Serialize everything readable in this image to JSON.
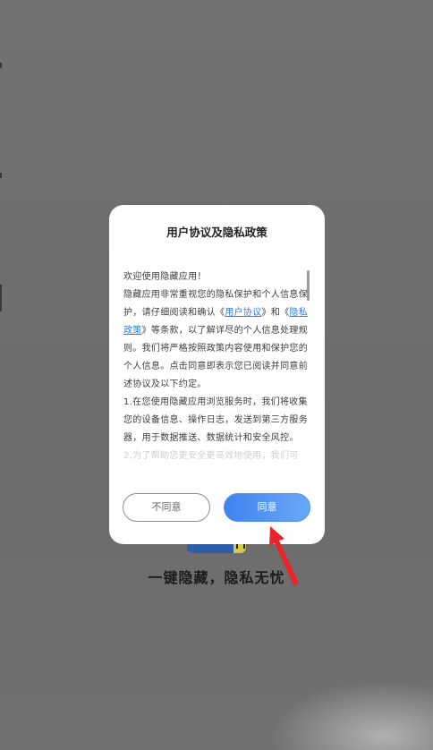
{
  "background": {
    "slogan": "一键隐藏，隐私无忧"
  },
  "dialog": {
    "title": "用户协议及隐私政策",
    "content": {
      "greeting": "欢迎使用隐藏应用！",
      "p1_before_link1": "隐藏应用非常重视您的隐私保护和个人信息保护，请仔细阅读和确认《",
      "link_user_agreement": "用户协议",
      "p1_between_links": "》和《",
      "link_privacy_policy": "隐私政策",
      "p1_after_link2": "》等条款，以了解详尽的个人信息处理规则。我们将严格按照政策内容使用和保护您的个人信息。点击同意即表示您已阅读并同意前述协议及以下约定。",
      "item1": "1.在您使用隐藏应用浏览服务时，我们将收集您的设备信息、操作日志，发送到第三方服务器，用于数据推送、数据统计和安全风控。",
      "item2_partial": "2.为了帮助您更安全更高效地使用，我们可"
    },
    "buttons": {
      "disagree": "不同意",
      "agree": "同意"
    }
  },
  "colors": {
    "overlay": "#6f6f6f",
    "link": "#2f7ee8",
    "agree_gradient_start": "#3f83ee",
    "agree_gradient_end": "#6aa8f7",
    "arrow": "#e8262a"
  }
}
